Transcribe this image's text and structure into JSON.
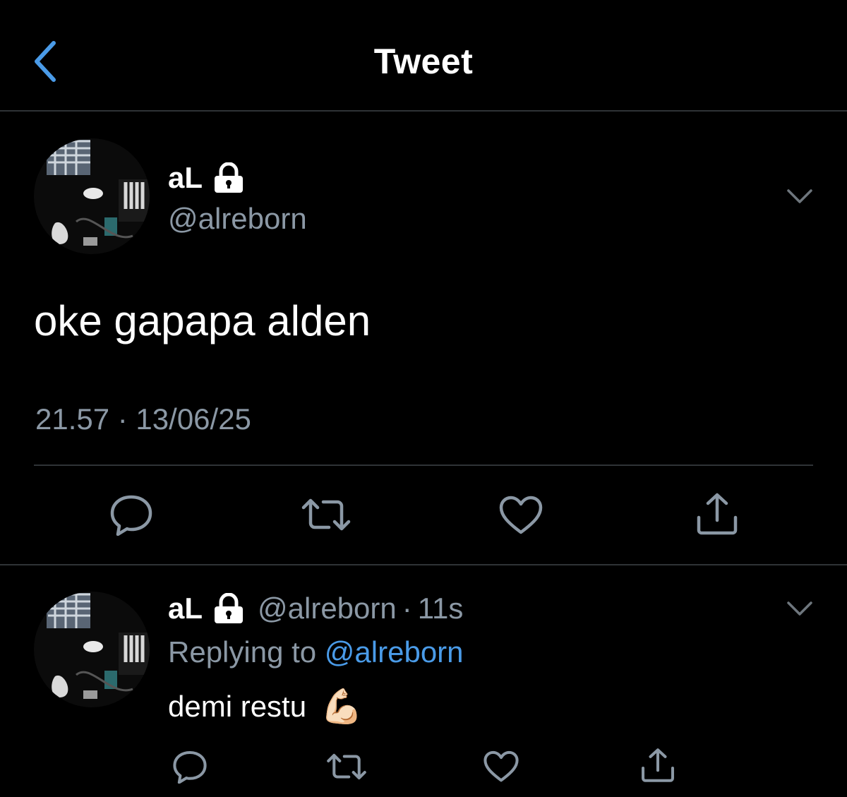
{
  "header": {
    "title": "Tweet"
  },
  "tweet": {
    "name": "aL",
    "handle": "@alreborn",
    "text": "oke gapapa alden",
    "timestamp": "21.57 · 13/06/25"
  },
  "reply": {
    "name": "aL",
    "handle": "@alreborn",
    "separator": "·",
    "time": "11s",
    "replying_prefix": "Replying to",
    "replying_handle": "@alreborn",
    "text": "demi restu",
    "emoji": "💪🏻"
  },
  "icons": {
    "back": "chevron-left-icon",
    "lock": "lock-icon",
    "more": "chevron-down-icon",
    "reply": "reply-icon",
    "retweet": "retweet-icon",
    "like": "heart-icon",
    "share": "share-icon"
  },
  "colors": {
    "background": "#000000",
    "accent": "#4a9be8",
    "secondary_text": "#8b98a5",
    "divider": "#2f3336"
  }
}
